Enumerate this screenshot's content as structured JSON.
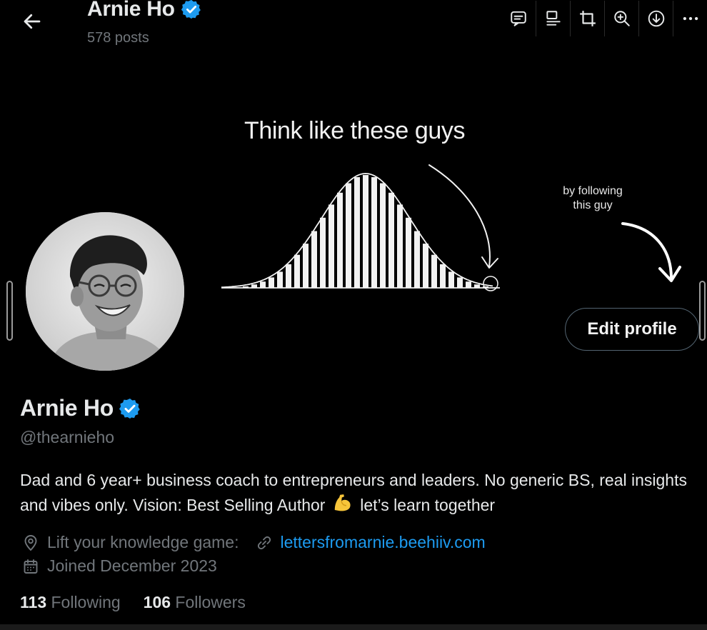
{
  "header": {
    "name": "Arnie Ho",
    "posts": "578 posts",
    "back_icon": "arrow-left-icon",
    "toolbar_icons": [
      "comment-icon",
      "text-align-icon",
      "crop-icon",
      "zoom-in-icon",
      "download-icon",
      "more-icon"
    ]
  },
  "banner": {
    "title": "Think like these guys",
    "side_text_line1": "by following",
    "side_text_line2": "this guy"
  },
  "profile": {
    "display_name": "Arnie Ho",
    "handle": "@thearnieho",
    "verified_icon": "verified-badge-icon",
    "edit_button": "Edit profile",
    "bio_part1": "Dad and 6 year+ business coach to entrepreneurs and leaders. No generic BS, real insights and vibes only. Vision: Best Selling Author",
    "bio_part2": "let’s learn together",
    "location": "Lift your knowledge game:",
    "link": "lettersfromarnie.beehiiv.com",
    "joined": "Joined December 2023",
    "following_count": "113",
    "following_label": "Following",
    "followers_count": "106",
    "followers_label": "Followers"
  },
  "colors": {
    "background": "#000000",
    "text_primary": "#e7e9ea",
    "text_secondary": "#71767b",
    "link": "#1d9bf0",
    "verified": "#1d9bf0"
  }
}
